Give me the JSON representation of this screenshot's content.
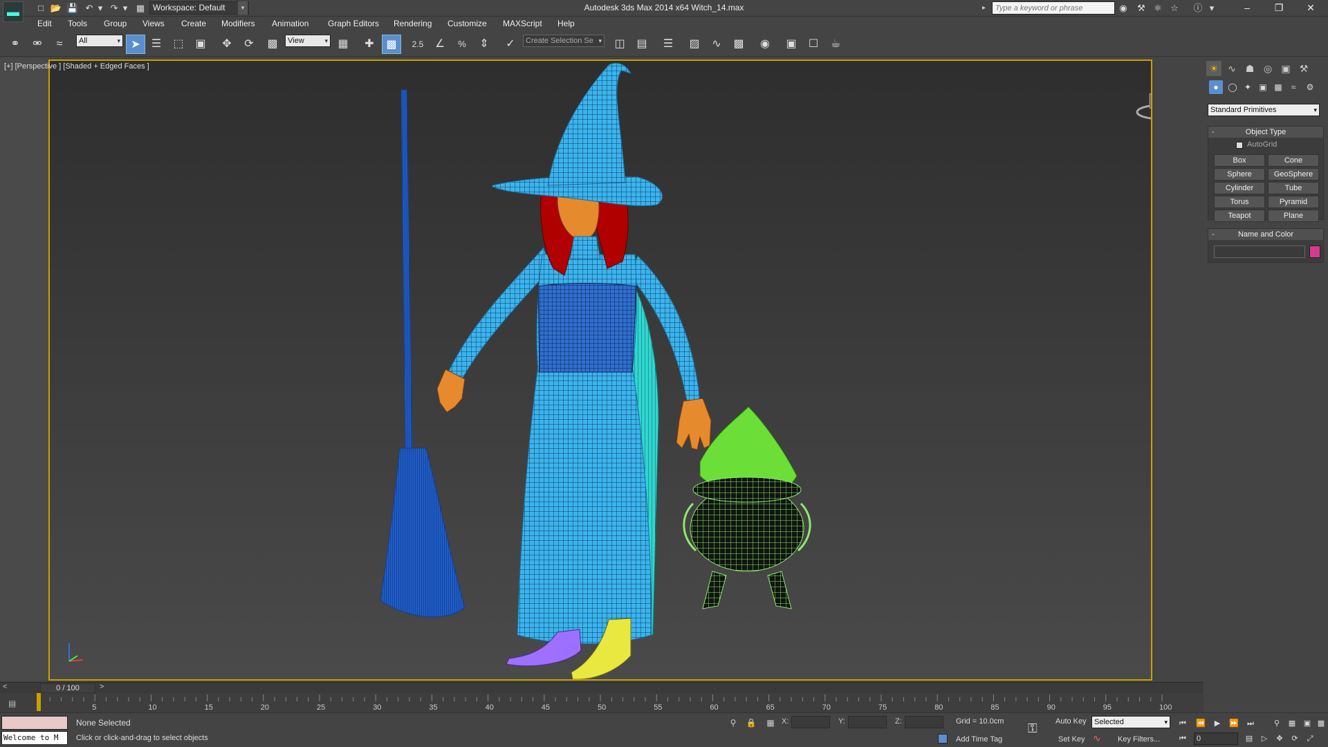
{
  "title_bar": {
    "workspace_label": "Workspace: Default",
    "app_title": "Autodesk 3ds Max  2014 x64     Witch_14.max",
    "search_placeholder": "Type a keyword or phrase"
  },
  "menu": {
    "items": [
      "Edit",
      "Tools",
      "Group",
      "Views",
      "Create",
      "Modifiers",
      "Animation",
      "Graph Editors",
      "Rendering",
      "Customize",
      "MAXScript",
      "Help"
    ]
  },
  "toolbar": {
    "selection_filter": "All",
    "ref_coord": "View",
    "snap_value": "2.5",
    "selection_set_placeholder": "Create Selection Se"
  },
  "viewport": {
    "label": "[+] [Perspective ] [Shaded + Edged Faces ]",
    "accent": "#c8a000"
  },
  "command_panel": {
    "primitive_type": "Standard Primitives",
    "object_type_title": "Object Type",
    "autogrid_label": "AutoGrid",
    "buttons": [
      "Box",
      "Cone",
      "Sphere",
      "GeoSphere",
      "Cylinder",
      "Tube",
      "Torus",
      "Pyramid",
      "Teapot",
      "Plane"
    ],
    "name_color_title": "Name and Color",
    "swatch_color": "#d63a8f"
  },
  "timeline": {
    "frame_counter": "0 / 100",
    "prev": "<",
    "next": ">",
    "ticks": [
      "5",
      "10",
      "15",
      "20",
      "25",
      "30",
      "35",
      "40",
      "45",
      "50",
      "55",
      "60",
      "65",
      "70",
      "75",
      "80",
      "85",
      "90",
      "95",
      "100"
    ]
  },
  "status": {
    "listener_text": "Welcome to M",
    "selection": "None Selected",
    "prompt": "Click or click-and-drag to select objects",
    "x_label": "X:",
    "y_label": "Y:",
    "z_label": "Z:",
    "grid": "Grid = 10.0cm",
    "add_time_tag": "Add Time Tag",
    "auto_key": "Auto Key",
    "set_key": "Set Key",
    "selected_dd": "Selected",
    "key_filters": "Key Filters...",
    "frame_value": "0"
  }
}
